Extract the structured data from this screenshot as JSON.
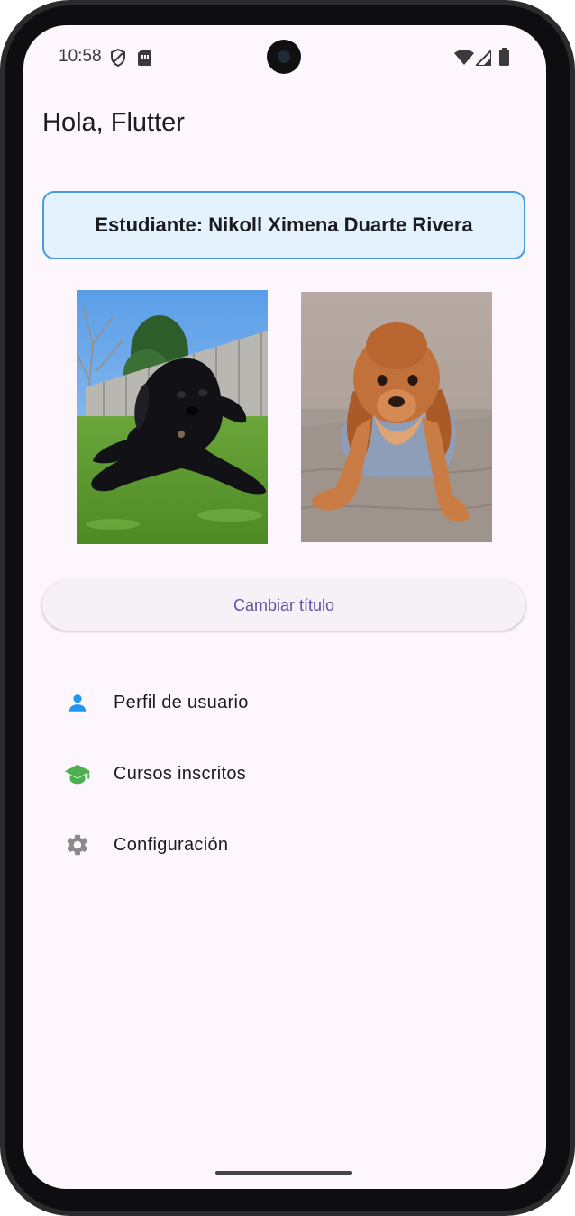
{
  "status_bar": {
    "time": "10:58",
    "icons_left": [
      "shield-icon",
      "sim-card-icon"
    ],
    "icons_right": [
      "wifi-icon",
      "signal-icon",
      "battery-icon"
    ]
  },
  "app": {
    "title": "Hola, Flutter"
  },
  "student_card": {
    "text": "Estudiante: Nikoll Ximena Duarte Rivera"
  },
  "images": [
    {
      "name": "black-cocker-spaniel-photo"
    },
    {
      "name": "brown-cocker-spaniel-photo"
    }
  ],
  "change_title_button": {
    "label": "Cambiar título"
  },
  "menu": [
    {
      "label": "Perfil de usuario",
      "icon": "person-icon",
      "icon_color": "#2196f3"
    },
    {
      "label": "Cursos inscritos",
      "icon": "school-icon",
      "icon_color": "#4caf50"
    },
    {
      "label": "Configuración",
      "icon": "settings-icon",
      "icon_color": "#8a8a8a"
    }
  ],
  "colors": {
    "screen_background": "#fdf6fd",
    "card_border": "#4a9be5",
    "card_background": "#e3f2fd",
    "button_text": "#6650a4"
  }
}
